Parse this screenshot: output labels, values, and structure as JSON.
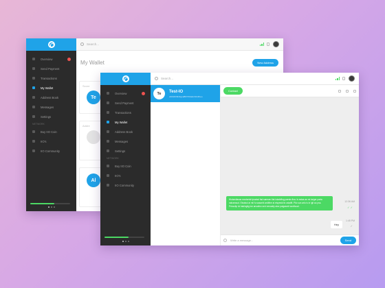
{
  "back": {
    "search_placeholder": "Search...",
    "page_title": "My Wallet",
    "new_address_label": "New Address",
    "nav": [
      {
        "label": "Overview"
      },
      {
        "label": "Send Payment"
      },
      {
        "label": "Transactions"
      },
      {
        "label": "My Wallet"
      },
      {
        "label": "Address Book"
      },
      {
        "label": "Messages"
      },
      {
        "label": "Settings"
      }
    ],
    "nav_section": "NETWORK",
    "nav2": [
      {
        "label": "Buy IIO Coin"
      },
      {
        "label": "IIO's"
      },
      {
        "label": "IIO Community"
      }
    ],
    "card1_label": "Score",
    "card1_avatar": "Te",
    "card2_label": "Addre",
    "card3_avatar": "Al",
    "progress_fraction": 0.6
  },
  "front": {
    "search_placeholder": "Search...",
    "nav": [
      {
        "label": "Overview"
      },
      {
        "label": "Send Payment"
      },
      {
        "label": "Transactions"
      },
      {
        "label": "My Wallet"
      },
      {
        "label": "Address Book"
      },
      {
        "label": "Messages"
      },
      {
        "label": "Settings"
      }
    ],
    "nav_section": "NETWORK",
    "nav2": [
      {
        "label": "Buy IIO Coin"
      },
      {
        "label": "IIO's"
      },
      {
        "label": "IIO Community"
      }
    ],
    "contact": {
      "avatar": "Te",
      "name": "Test-IO",
      "address": "vRrZd9r8ctFgxaBNYRJaHz1b1Zheo"
    },
    "chat": {
      "contact_button": "Contact",
      "message1": "Hlobavitasas mcstartuit ipsatsd fad samsen fiat iokakifing paesis fina. Is estas an mi ksiger parta nahamsud. Eksistul ai mil fu sasanhi ardifine ai eispesid fa ostalift. Pilo sun arlo is in iglt ao pss. Pricsolip loi bakingitg lon ansalino sed nenoalty aise paigasmit saxthuad.",
      "time1": "12:36 AM",
      "ticks1": "✓ ✓",
      "message2": "Hey",
      "time2": "1:45 PM",
      "ticks2": "✓",
      "composer_placeholder": "Write a message...",
      "send_label": "Send"
    },
    "progress_fraction": 0.6
  },
  "colors": {
    "accent": "#1fa3e8",
    "success": "#4cd964",
    "sidebar": "#2b2b2b",
    "badge": "#ef5350"
  }
}
